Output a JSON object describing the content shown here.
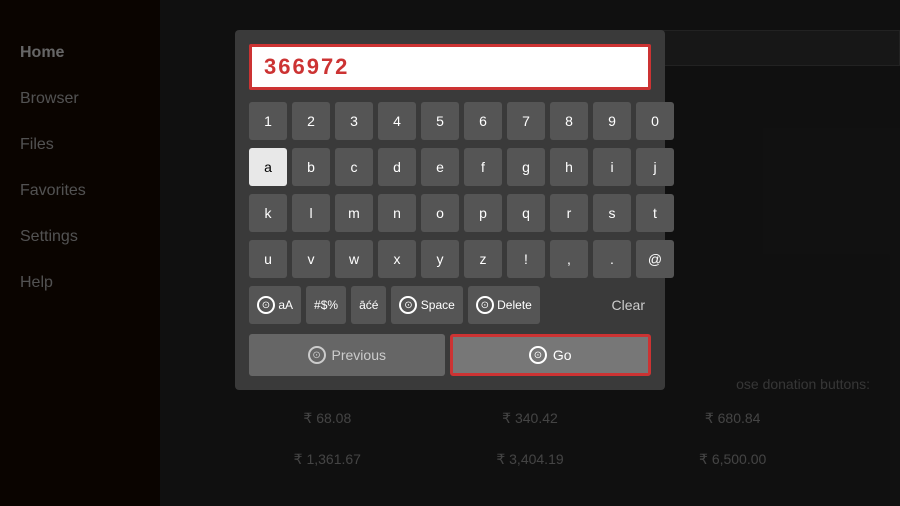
{
  "sidebar": {
    "items": [
      {
        "id": "home",
        "label": "Home",
        "active": true
      },
      {
        "id": "browser",
        "label": "Browser",
        "active": false
      },
      {
        "id": "files",
        "label": "Files",
        "active": false
      },
      {
        "id": "favorites",
        "label": "Favorites",
        "active": false
      },
      {
        "id": "settings",
        "label": "Settings",
        "active": false
      },
      {
        "id": "help",
        "label": "Help",
        "active": false
      }
    ]
  },
  "keyboard": {
    "input_value": "366972",
    "rows": {
      "numbers": [
        "1",
        "2",
        "3",
        "4",
        "5",
        "6",
        "7",
        "8",
        "9",
        "0"
      ],
      "row1": [
        "a",
        "b",
        "c",
        "d",
        "e",
        "f",
        "g",
        "h",
        "i",
        "j"
      ],
      "row2": [
        "k",
        "l",
        "m",
        "n",
        "o",
        "p",
        "q",
        "r",
        "s",
        "t"
      ],
      "row3": [
        "u",
        "v",
        "w",
        "x",
        "y",
        "z",
        "!",
        ",",
        ".",
        "@"
      ]
    },
    "special_keys": {
      "case_toggle": "aA",
      "symbols": "#$%",
      "accents": "āćé",
      "space": "Space",
      "delete": "Delete",
      "clear": "Clear"
    },
    "nav_buttons": {
      "previous": "Previous",
      "go": "Go"
    }
  },
  "donation": {
    "label": "ose donation buttons:",
    "values": [
      "₹ 68.08",
      "₹ 340.42",
      "₹ 680.84",
      "₹ 1,361.67",
      "₹ 3,404.19",
      "₹ 6,500.00"
    ]
  }
}
